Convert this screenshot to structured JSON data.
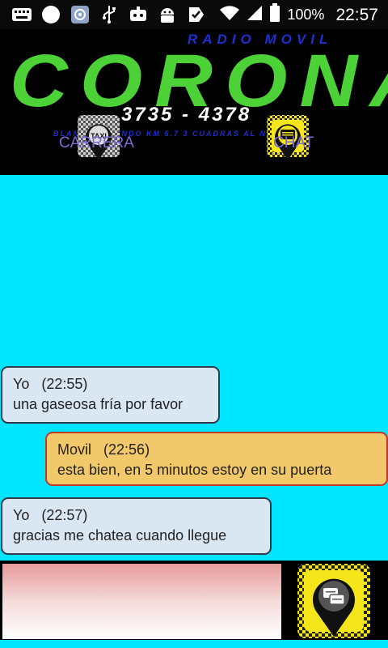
{
  "status_bar": {
    "battery_percent": "100%",
    "time": "22:57",
    "icons": [
      "keyboard-icon",
      "circle-icon",
      "app-icon",
      "usb-icon",
      "robot-icon",
      "android-icon",
      "check-icon",
      "wifi-icon",
      "signal-icon",
      "battery-icon"
    ]
  },
  "header": {
    "brand_top": "RADIO MOVIL",
    "brand_main": "CORONA",
    "phone": "3735 - 4378",
    "address": "BLANCO GALINDO KM 6.7 3 CUADRAS AL NORTE",
    "tabs": [
      {
        "label": "CARRERA",
        "icon": "taxi-pin-icon",
        "selected": false
      },
      {
        "label": "CHAT",
        "icon": "chat-pin-icon",
        "selected": true
      }
    ],
    "accent_color": "#e05a7f"
  },
  "chat": {
    "messages": [
      {
        "sender": "Yo",
        "time": "(22:55)",
        "text": "una gaseosa fría por favor",
        "from_me": true
      },
      {
        "sender": "Movil",
        "time": "(22:56)",
        "text": "esta bien, en 5 minutos estoy en su puerta",
        "from_me": false
      },
      {
        "sender": "Yo",
        "time": "(22:57)",
        "text": "gracias me chatea cuando llegue",
        "from_me": true
      }
    ]
  },
  "composer": {
    "value": "",
    "placeholder": "",
    "send_icon": "chat-pin-icon"
  },
  "colors": {
    "background": "#00e5ff",
    "bubble_me": "#d9e7f3",
    "bubble_driver": "#f2c96a",
    "brand_green": "#4cd137",
    "brand_blue": "#1e2fd0"
  }
}
